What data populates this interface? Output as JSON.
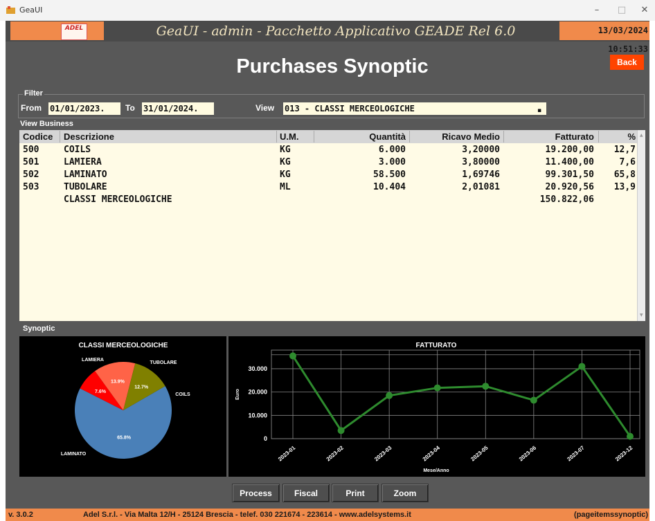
{
  "window": {
    "title": "GeaUI",
    "controls": {
      "minimize": "–",
      "maximize": "□",
      "close": "✕"
    }
  },
  "banner": {
    "logo_text": "ADEL",
    "title": "GeaUI - admin - Pacchetto Applicativo GEADE Rel 6.0",
    "datetime": "13/03/2024 10:51:33"
  },
  "page": {
    "title": "Purchases Synoptic",
    "back_label": "Back"
  },
  "filter": {
    "section_label": "Filter",
    "from_label": "From",
    "from_value": "01/01/2023.",
    "to_label": "To",
    "to_value": "31/01/2024.",
    "view_label": "View",
    "view_value": "013 - CLASSI MERCEOLOGICHE"
  },
  "business": {
    "section_label": "View Business",
    "columns": {
      "codice": "Codice",
      "descrizione": "Descrizione",
      "um": "U.M.",
      "quantita": "Quantità",
      "ricavo": "Ricavo Medio",
      "fatturato": "Fatturato",
      "perc": "%"
    },
    "rows": [
      {
        "codice": "500",
        "descrizione": "COILS",
        "um": "KG",
        "quantita": "6.000",
        "ricavo": "3,20000",
        "fatturato": "19.200,00",
        "perc": "12,7"
      },
      {
        "codice": "501",
        "descrizione": "LAMIERA",
        "um": "KG",
        "quantita": "3.000",
        "ricavo": "3,80000",
        "fatturato": "11.400,00",
        "perc": "7,6"
      },
      {
        "codice": "502",
        "descrizione": "LAMINATO",
        "um": "KG",
        "quantita": "58.500",
        "ricavo": "1,69746",
        "fatturato": "99.301,50",
        "perc": "65,8"
      },
      {
        "codice": "503",
        "descrizione": "TUBOLARE",
        "um": "ML",
        "quantita": "10.404",
        "ricavo": "2,01081",
        "fatturato": "20.920,56",
        "perc": "13,9"
      }
    ],
    "total": {
      "descrizione": "CLASSI MERCEOLOGICHE",
      "fatturato": "150.822,06"
    }
  },
  "synoptic": {
    "section_label": "Synoptic"
  },
  "chart_data": [
    {
      "type": "pie",
      "title": "CLASSI MERCEOLOGICHE",
      "slices": [
        {
          "label": "LAMINATO",
          "value": 65.8,
          "pct_label": "65.8%",
          "color": "#4a80b8"
        },
        {
          "label": "LAMIERA",
          "value": 7.6,
          "pct_label": "7.6%",
          "color": "#ff0000"
        },
        {
          "label": "TUBOLARE",
          "value": 13.9,
          "pct_label": "13.9%",
          "color": "#ff6347"
        },
        {
          "label": "COILS",
          "value": 12.7,
          "pct_label": "12.7%",
          "color": "#808000"
        }
      ]
    },
    {
      "type": "line",
      "title": "FATTURATO",
      "xlabel": "Mese/Anno",
      "ylabel": "Euro",
      "x": [
        "2023-01",
        "2023-02",
        "2023-03",
        "2023-04",
        "2023-05",
        "2023-06",
        "2023-07",
        "2023-12"
      ],
      "values": [
        35500,
        3500,
        18500,
        21800,
        22500,
        16500,
        31000,
        1000
      ],
      "ylim": [
        0,
        38000
      ],
      "yticks": [
        "0",
        "10.000",
        "20.000",
        "30.000"
      ],
      "ytick_values": [
        0,
        10000,
        20000,
        30000
      ],
      "color": "#2e8b2e",
      "grid": true
    }
  ],
  "buttons": {
    "process": "Process",
    "fiscal": "Fiscal",
    "print": "Print",
    "zoom": "Zoom"
  },
  "status": {
    "version": "v. 3.0.2",
    "company": "Adel S.r.l. - Via Malta 12/H - 25124 Brescia - telef. 030 221674 - 223614 - www.adelsystems.it",
    "page_id": "(pageitemssynoptic)"
  }
}
